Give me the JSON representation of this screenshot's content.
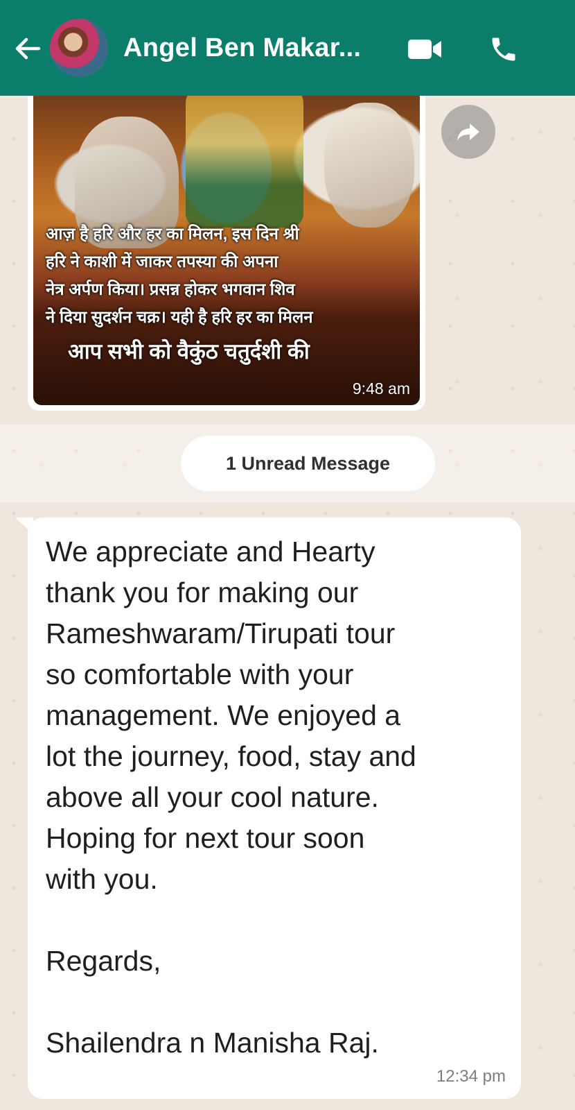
{
  "header": {
    "contact_name": "Angel Ben Makar...",
    "background_color": "#0b7d6b",
    "icons": {
      "back": "arrow-left-icon",
      "video": "video-camera-icon",
      "call": "phone-icon"
    }
  },
  "messages": [
    {
      "type": "image",
      "caption_lines": "आज़ है हरि और हर का मिलन, इस दिन श्री\nहरि ने काशी में जाकर तपस्या की अपना\nनेत्र अर्पण किया। प्रसन्न होकर भगवान शिव\nने दिया सुदर्शन चक्र। यही है हरि हर का मिलन",
      "greeting": "आप सभी को वैकुंठ चतुर्दशी की",
      "time": "9:48 am"
    },
    {
      "type": "text",
      "body": "We appreciate and Hearty\nthank you for making our\nRameshwaram/Tirupati tour\nso comfortable with your\nmanagement. We enjoyed a\nlot the journey, food, stay and\nabove all your cool nature.\nHoping for next tour soon\nwith you.\n\nRegards,\n\nShailendra n Manisha Raj.",
      "time": "12:34 pm"
    }
  ],
  "unread_divider": "1 Unread Message"
}
